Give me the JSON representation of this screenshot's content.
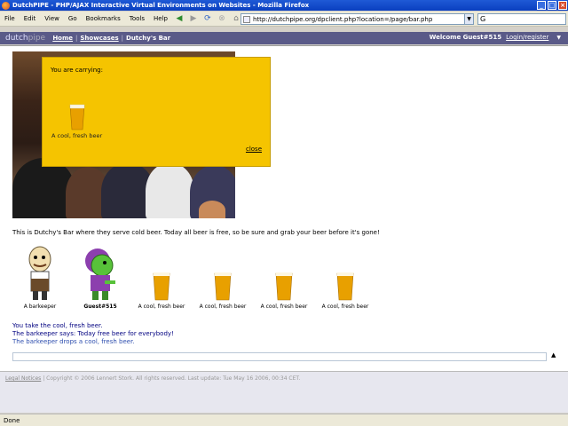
{
  "window": {
    "title": "DutchPIPE - PHP/AJAX Interactive Virtual Environments on Websites - Mozilla Firefox"
  },
  "menu": [
    "File",
    "Edit",
    "View",
    "Go",
    "Bookmarks",
    "Tools",
    "Help"
  ],
  "address": {
    "url": "http://dutchpipe.org/dpclient.php?location=/page/bar.php"
  },
  "site": {
    "logo_a": "dutch",
    "logo_b": "pipe",
    "breadcrumb": [
      "Home",
      "Showcases",
      "Dutchy's Bar"
    ],
    "welcome": "Welcome Guest#515",
    "login": "Login/register",
    "collapse": "▼"
  },
  "carry": {
    "title": "You are carrying:",
    "item_label": "A cool, fresh beer",
    "close": "close"
  },
  "description": "This is Dutchy's Bar where they serve cold beer. Today all beer is free, so be sure and grab your beer before it's gone!",
  "items": [
    {
      "label": "A barkeeper"
    },
    {
      "label": "Guest#515"
    },
    {
      "label": "A cool, fresh beer"
    },
    {
      "label": "A cool, fresh beer"
    },
    {
      "label": "A cool, fresh beer"
    },
    {
      "label": "A cool, fresh beer"
    }
  ],
  "log": [
    "You take the cool, fresh beer.",
    "The barkeeper says: Today free beer for everybody!",
    "The barkeeper drops a cool, fresh beer."
  ],
  "footer": {
    "legal": "Legal Notices",
    "text": "| Copyright © 2006 Lennert Stork. All rights reserved. Last update: Tue May 16 2006, 00:34 CET."
  },
  "status": "Done",
  "colors": {
    "sitenav": "#5a5a88",
    "carry_panel": "#f5c400",
    "log_text": "#000080"
  }
}
